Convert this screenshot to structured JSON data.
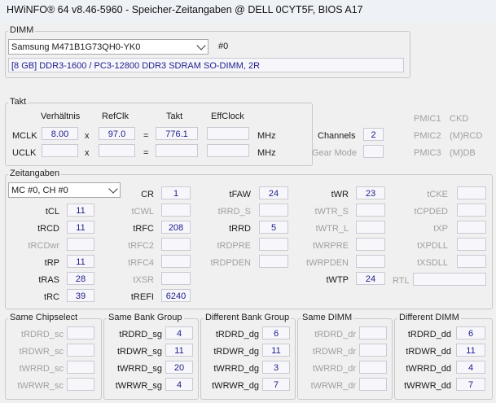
{
  "title": "HWiNFO® 64 v8.46-5960 - Speicher-Zeitangaben @ DELL 0CYT5F, BIOS A17",
  "dimm": {
    "legend": "DIMM",
    "selected_module": "Samsung M471B1G73QH0-YK0",
    "slot": "#0",
    "description": "[8 GB] DDR3-1600 / PC3-12800 DDR3 SDRAM SO-DIMM, 2R"
  },
  "takt": {
    "legend": "Takt",
    "headers": {
      "ratio": "Verhältnis",
      "refclk": "RefClk",
      "takt": "Takt",
      "effclock": "EffClock"
    },
    "mclk": {
      "label": "MCLK",
      "ratio": "8.00",
      "x": "x",
      "refclk": "97.0",
      "eq": "=",
      "takt": "776.1",
      "effclock": "",
      "unit": "MHz"
    },
    "uclk": {
      "label": "UCLK",
      "ratio": "",
      "x": "x",
      "refclk": "",
      "eq": "=",
      "takt": "",
      "effclock": "",
      "unit": "MHz"
    },
    "channels_label": "Channels",
    "channels": "2",
    "gear_label": "Gear Mode",
    "gear": "",
    "pmic": [
      {
        "label": "PMIC1",
        "value": "CKD"
      },
      {
        "label": "PMIC2",
        "value": "(M)RCD"
      },
      {
        "label": "PMIC3",
        "value": "(M)DB"
      }
    ]
  },
  "zeit": {
    "legend": "Zeitangaben",
    "channel_select": "MC #0, CH #0",
    "col1": [
      {
        "label": "tCL",
        "value": "11",
        "active": true
      },
      {
        "label": "tRCD",
        "value": "11",
        "active": true
      },
      {
        "label": "tRCDwr",
        "value": "",
        "active": false
      },
      {
        "label": "tRP",
        "value": "11",
        "active": true
      },
      {
        "label": "tRAS",
        "value": "28",
        "active": true
      },
      {
        "label": "tRC",
        "value": "39",
        "active": true
      }
    ],
    "col2": [
      {
        "label": "CR",
        "value": "1",
        "active": true
      },
      {
        "label": "tCWL",
        "value": "",
        "active": false
      },
      {
        "label": "tRFC",
        "value": "208",
        "active": true
      },
      {
        "label": "tRFC2",
        "value": "",
        "active": false
      },
      {
        "label": "tRFC4",
        "value": "",
        "active": false
      },
      {
        "label": "tXSR",
        "value": "",
        "active": false
      },
      {
        "label": "tREFI",
        "value": "6240",
        "active": true
      }
    ],
    "col3": [
      {
        "label": "tFAW",
        "value": "24",
        "active": true
      },
      {
        "label": "tRRD_S",
        "value": "",
        "active": false
      },
      {
        "label": "tRRD",
        "value": "5",
        "active": true
      },
      {
        "label": "tRDPRE",
        "value": "",
        "active": false
      },
      {
        "label": "tRDPDEN",
        "value": "",
        "active": false
      }
    ],
    "col4": [
      {
        "label": "tWR",
        "value": "23",
        "active": true
      },
      {
        "label": "tWTR_S",
        "value": "",
        "active": false
      },
      {
        "label": "tWTR_L",
        "value": "",
        "active": false
      },
      {
        "label": "tWRPRE",
        "value": "",
        "active": false
      },
      {
        "label": "tWRPDEN",
        "value": "",
        "active": false
      },
      {
        "label": "tWTP",
        "value": "24",
        "active": true
      }
    ],
    "col5": [
      {
        "label": "tCKE",
        "value": "",
        "active": false
      },
      {
        "label": "tCPDED",
        "value": "",
        "active": false
      },
      {
        "label": "tXP",
        "value": "",
        "active": false
      },
      {
        "label": "tXPDLL",
        "value": "",
        "active": false
      },
      {
        "label": "tXSDLL",
        "value": "",
        "active": false
      }
    ],
    "rtl_label": "RTL",
    "rtl": ""
  },
  "groups": [
    {
      "legend": "Same Chipselect",
      "rows": [
        {
          "label": "tRDRD_sc",
          "value": "",
          "active": false
        },
        {
          "label": "tRDWR_sc",
          "value": "",
          "active": false
        },
        {
          "label": "tWRRD_sc",
          "value": "",
          "active": false
        },
        {
          "label": "tWRWR_sc",
          "value": "",
          "active": false
        }
      ]
    },
    {
      "legend": "Same Bank Group",
      "rows": [
        {
          "label": "tRDRD_sg",
          "value": "4",
          "active": true
        },
        {
          "label": "tRDWR_sg",
          "value": "11",
          "active": true
        },
        {
          "label": "tWRRD_sg",
          "value": "20",
          "active": true
        },
        {
          "label": "tWRWR_sg",
          "value": "4",
          "active": true
        }
      ]
    },
    {
      "legend": "Different Bank Group",
      "rows": [
        {
          "label": "tRDRD_dg",
          "value": "6",
          "active": true
        },
        {
          "label": "tRDWR_dg",
          "value": "11",
          "active": true
        },
        {
          "label": "tWRRD_dg",
          "value": "3",
          "active": true
        },
        {
          "label": "tWRWR_dg",
          "value": "7",
          "active": true
        }
      ]
    },
    {
      "legend": "Same DIMM",
      "rows": [
        {
          "label": "tRDRD_dr",
          "value": "",
          "active": false
        },
        {
          "label": "tRDWR_dr",
          "value": "",
          "active": false
        },
        {
          "label": "tWRRD_dr",
          "value": "",
          "active": false
        },
        {
          "label": "tWRWR_dr",
          "value": "",
          "active": false
        }
      ]
    },
    {
      "legend": "Different DIMM",
      "rows": [
        {
          "label": "tRDRD_dd",
          "value": "6",
          "active": true
        },
        {
          "label": "tRDWR_dd",
          "value": "11",
          "active": true
        },
        {
          "label": "tWRRD_dd",
          "value": "4",
          "active": true
        },
        {
          "label": "tWRWR_dd",
          "value": "7",
          "active": true
        }
      ]
    }
  ]
}
